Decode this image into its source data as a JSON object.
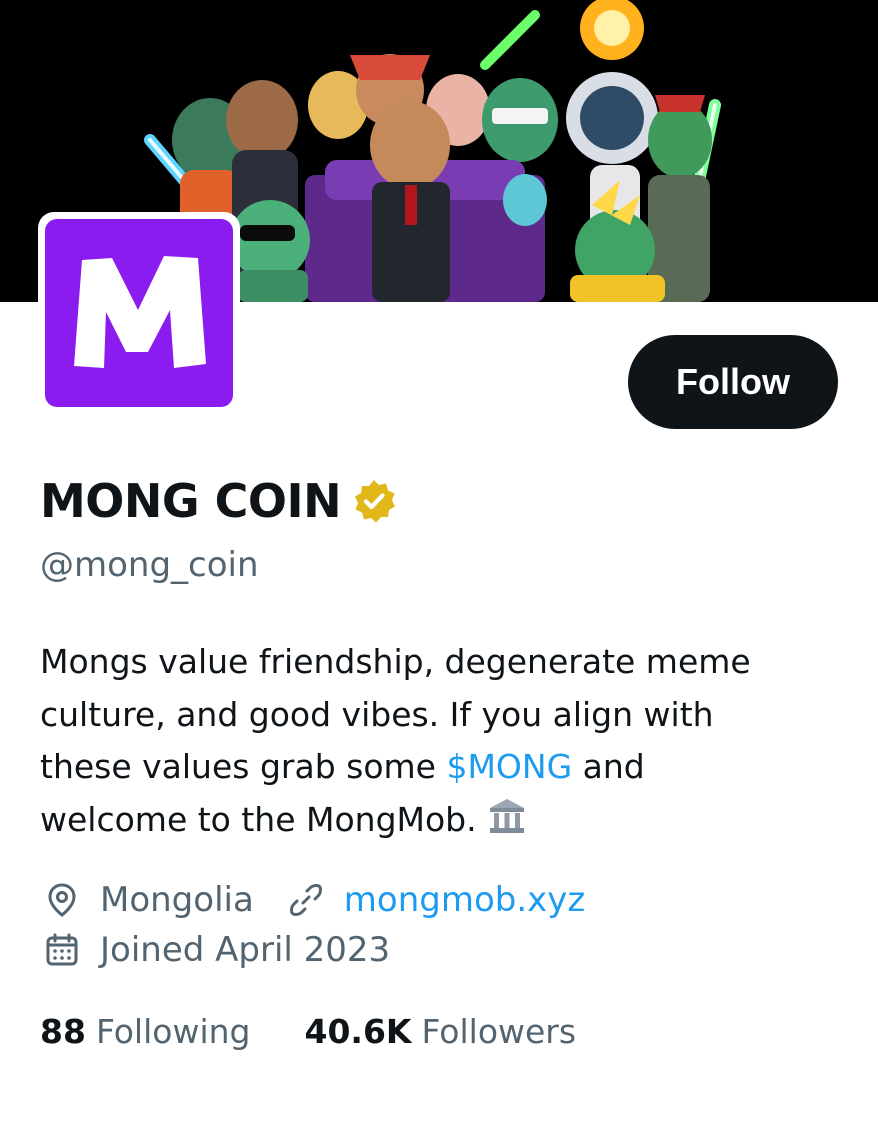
{
  "profile": {
    "display_name": "MONG COIN",
    "handle": "@mong_coin",
    "avatar_letter": "M",
    "follow_label": "Follow",
    "bio": {
      "line1": "Mongs value friendship, degenerate meme",
      "line2": "culture, and good vibes. If you align with",
      "line3_pre": "these values grab some ",
      "line3_link": "$MONG",
      "line3_post": " and",
      "line4": "welcome to the MongMob."
    },
    "location": "Mongolia",
    "website": "mongmob.xyz",
    "joined": "Joined April 2023",
    "following_count": "88",
    "following_label": "Following",
    "followers_count": "40.6K",
    "followers_label": "Followers"
  },
  "colors": {
    "avatar_bg": "#8b1cf0",
    "button_bg": "#0f1419",
    "link": "#1d9bf0",
    "secondary_text": "#536471",
    "verified_badge": "#e2b719"
  },
  "icons": {
    "verified": "verified-badge-icon",
    "location": "location-pin-icon",
    "link": "link-icon",
    "calendar": "calendar-icon",
    "bio_emoji": "classical-building-icon"
  }
}
